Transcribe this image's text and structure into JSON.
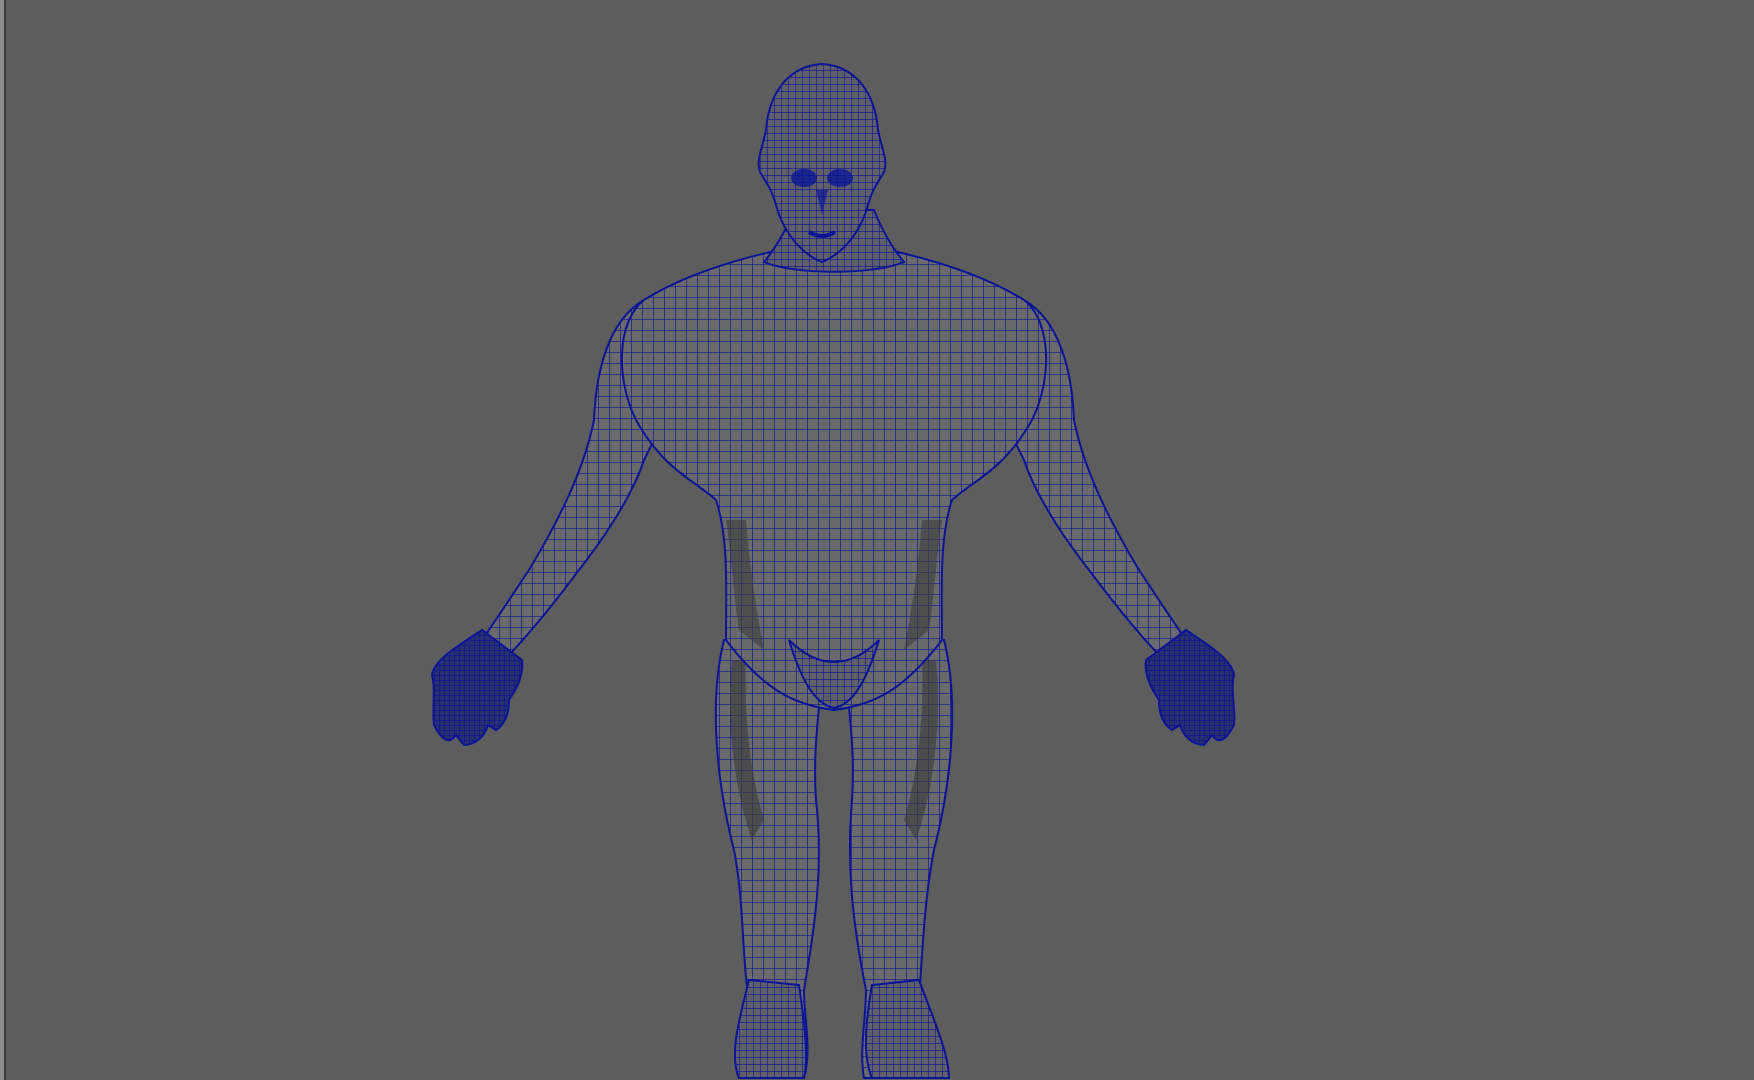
{
  "viewport": {
    "background_color": "#5d5d5d",
    "frame_color": "#8e8e8e",
    "display_mode": "wireframe-on-shaded"
  },
  "model": {
    "name": "human-male-base-mesh",
    "pose": "A-pose",
    "wire_color": "#0a1496",
    "shade_color": "#6a6a6a",
    "shade_dark_color": "#3c3c3c"
  }
}
